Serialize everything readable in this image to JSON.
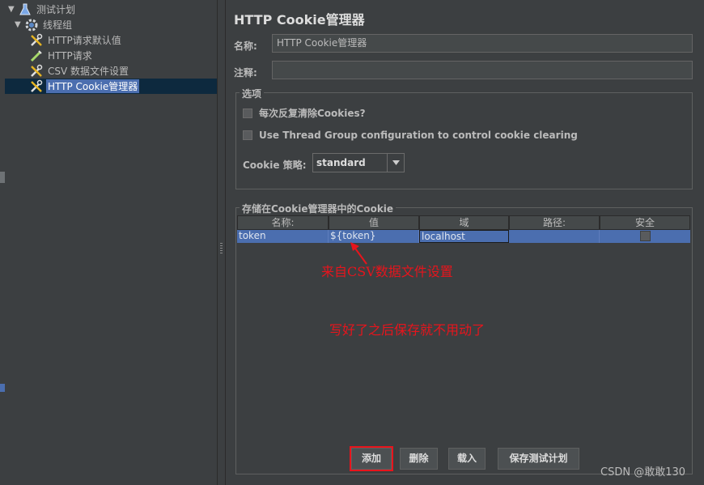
{
  "tree": {
    "items": [
      {
        "label": "测试计划",
        "icon": "test-plan-icon"
      },
      {
        "label": "线程组",
        "icon": "thread-group-gear-icon"
      },
      {
        "label": "HTTP请求默认值",
        "icon": "config-wrench-icon"
      },
      {
        "label": "HTTP请求",
        "icon": "sampler-pipette-icon"
      },
      {
        "label": "CSV 数据文件设置",
        "icon": "config-wrench-icon"
      },
      {
        "label": "HTTP Cookie管理器",
        "icon": "config-wrench-icon"
      }
    ]
  },
  "panel": {
    "title": "HTTP Cookie管理器",
    "name_label": "名称:",
    "name_value": "HTTP Cookie管理器",
    "comment_label": "注释:",
    "comment_value": ""
  },
  "options": {
    "title": "选项",
    "clear_each_iteration": "每次反复清除Cookies?",
    "use_thread_group": "Use Thread Group configuration to control cookie clearing",
    "policy_label": "Cookie 策略:",
    "policy_value": "standard"
  },
  "cookies": {
    "title": "存储在Cookie管理器中的Cookie",
    "columns": [
      "名称:",
      "值",
      "域",
      "路径:",
      "安全"
    ],
    "rows": [
      {
        "name": "token",
        "value": "${token}",
        "domain": "localhost",
        "path": "",
        "secure": false
      }
    ]
  },
  "annotations": {
    "source_note": "来自CSV数据文件设置",
    "save_note": "写好了之后保存就不用动了"
  },
  "buttons": {
    "add": "添加",
    "delete": "删除",
    "load": "载入",
    "save": "保存测试计划"
  },
  "watermark": "CSDN @敢敢130",
  "colors": {
    "background": "#3c3f41",
    "selection": "#4b6eaf",
    "annotation": "#e8141c"
  }
}
